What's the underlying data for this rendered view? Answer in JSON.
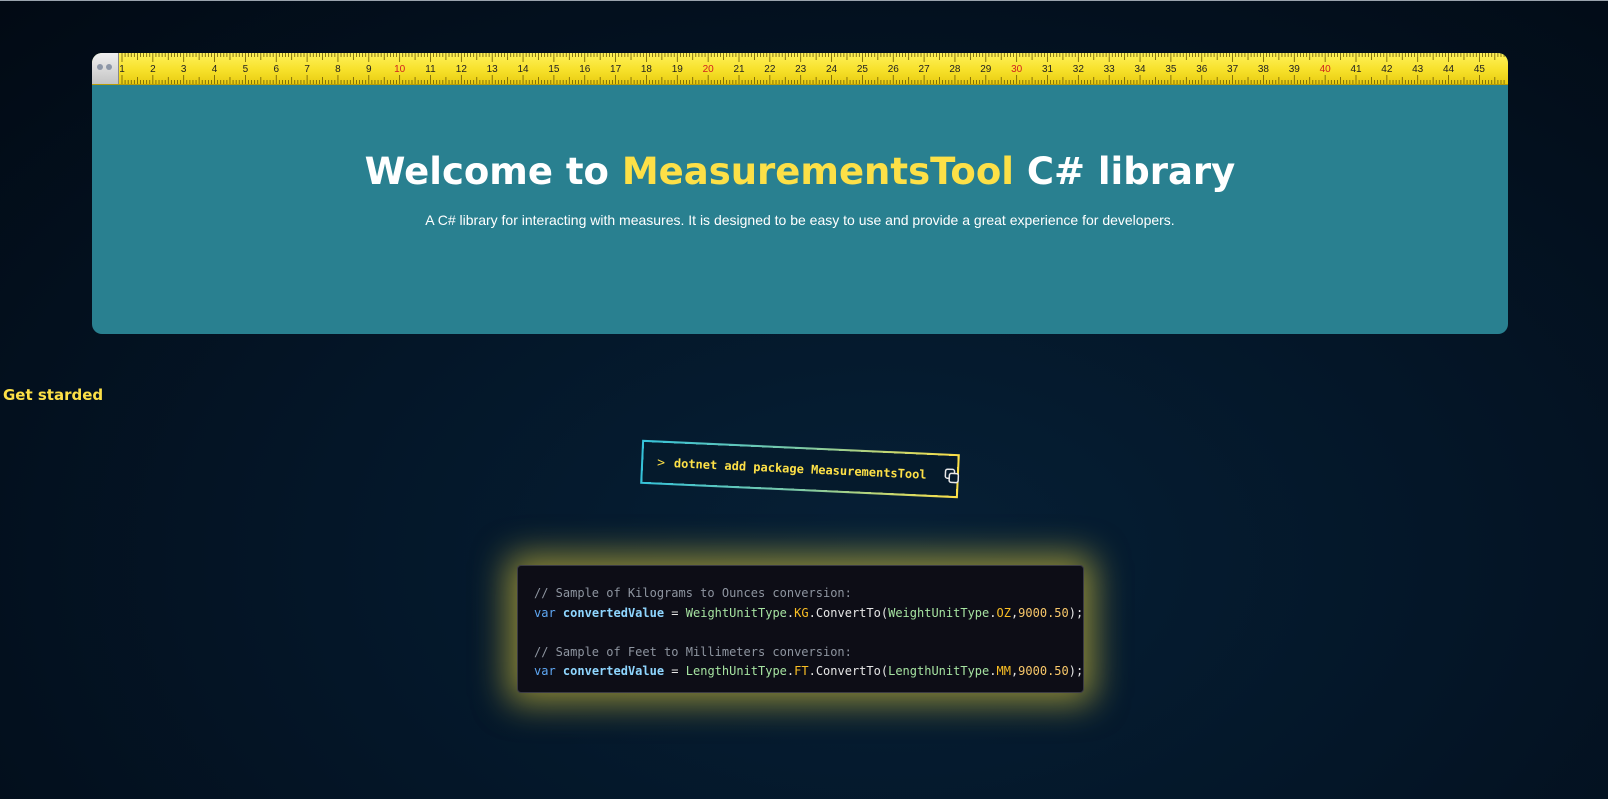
{
  "hero": {
    "title_prefix": "Welcome to ",
    "title_accent": "MeasurementsTool",
    "title_suffix": " C# library",
    "subtitle": "A C# library for interacting with measures. It is designed to be easy to use and provide a great experience for developers.",
    "ruler_numbers": [
      "1",
      "2",
      "3",
      "4",
      "5",
      "6",
      "7",
      "8",
      "9",
      "10",
      "11",
      "12",
      "13",
      "14",
      "15",
      "16",
      "17",
      "18",
      "19",
      "20",
      "21",
      "22",
      "23",
      "24",
      "25",
      "26",
      "27",
      "28",
      "29",
      "30",
      "31",
      "32",
      "33",
      "34",
      "35",
      "36",
      "37",
      "38",
      "39",
      "40",
      "41",
      "42",
      "43",
      "44",
      "45"
    ],
    "ruler_highlight_numbers": [
      "10",
      "20",
      "30",
      "40"
    ],
    "ruler_color": "#f7e12a",
    "ruler_highlight_color": "#d02020"
  },
  "get_started": {
    "heading": "Get starded"
  },
  "install": {
    "prompt": ">",
    "command": "dotnet add package MeasurementsTool",
    "copy_icon": "copy-icon"
  },
  "code": {
    "lines": [
      {
        "comment": "// Sample of Kilograms to Ounces conversion:"
      },
      {
        "kw": "var",
        "var": "convertedValue",
        "eq": " = ",
        "type1": "WeightUnitType",
        "dot1": ".",
        "const1": "KG",
        "call": ".ConvertTo(",
        "type2": "WeightUnitType",
        "dot2": ".",
        "const2": "OZ",
        "comma": ",",
        "num": "9000.50",
        "end": ");"
      },
      {
        "blank": ""
      },
      {
        "comment": "// Sample of Feet to Millimeters conversion:"
      },
      {
        "kw": "var",
        "var": "convertedValue",
        "eq": " = ",
        "type1": "LengthUnitType",
        "dot1": ".",
        "const1": "FT",
        "call": ".ConvertTo(",
        "type2": "LengthUnitType",
        "dot2": ".",
        "const2": "MM",
        "comma": ",",
        "num": "9000.50",
        "end": ");"
      }
    ]
  },
  "colors": {
    "accent": "#fde047",
    "hero_bg": "#298090",
    "page_bg": "#041628"
  }
}
